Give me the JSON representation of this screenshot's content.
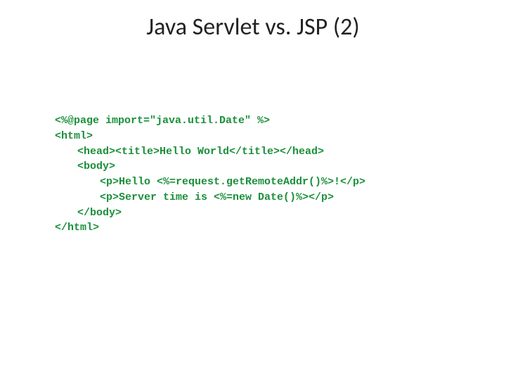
{
  "slide": {
    "title": "Java Servlet vs. JSP (2)",
    "code": {
      "l1": "<%@page import=\"java.util.Date\" %>",
      "l2": "<html>",
      "l3": "<head><title>Hello World</title></head>",
      "l4": "<body>",
      "l5": "<p>Hello <%=request.getRemoteAddr()%>!</p>",
      "l6": "<p>Server time is <%=new Date()%></p>",
      "l7": "</body>",
      "l8": "</html>"
    }
  }
}
